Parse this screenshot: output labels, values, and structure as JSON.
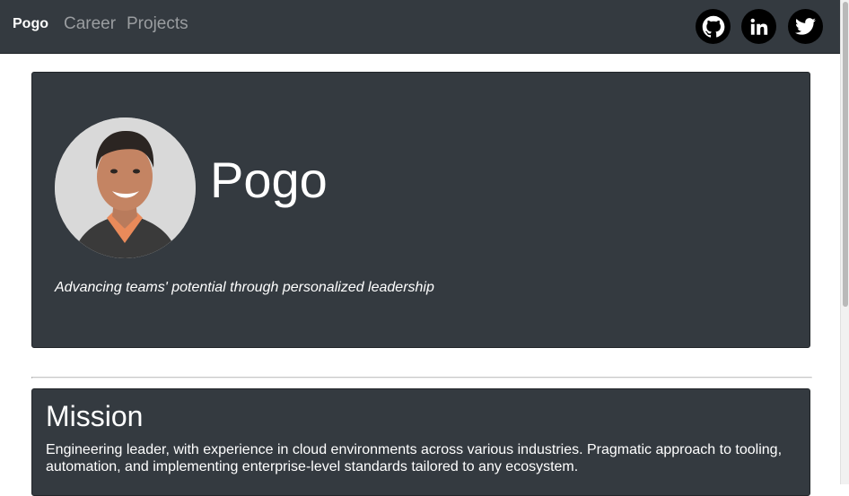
{
  "nav": {
    "brand": "Pogo",
    "links": [
      {
        "label": "Career"
      },
      {
        "label": "Projects"
      }
    ],
    "social": [
      {
        "icon": "github-icon"
      },
      {
        "icon": "linkedin-icon"
      },
      {
        "icon": "twitter-icon"
      }
    ]
  },
  "hero": {
    "name": "Pogo",
    "tagline": "Advancing teams' potential through personalized leadership"
  },
  "mission": {
    "title": "Mission",
    "text": "Engineering leader, with experience in cloud environments across various industries. Pragmatic approach to tooling, automation, and implementing enterprise-level standards tailored to any ecosystem."
  },
  "colors": {
    "navbar": "#343a40",
    "card": "#343a40",
    "nav_link": "#9a9da0",
    "page_bg": "#ffffff"
  }
}
